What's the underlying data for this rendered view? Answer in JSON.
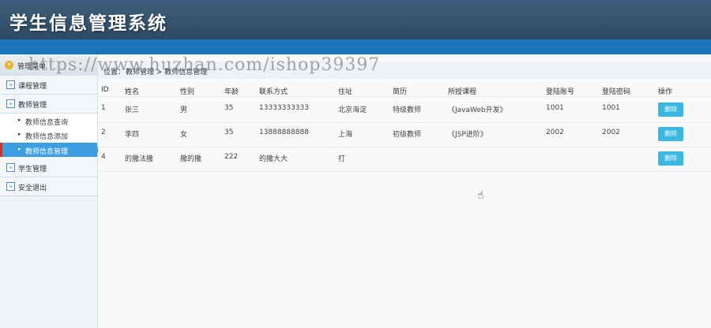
{
  "app": {
    "title": "学生信息管理系统"
  },
  "sidebar": {
    "header_label": "管理菜单",
    "items": [
      {
        "label": "课程管理"
      },
      {
        "label": "教师管理"
      },
      {
        "label": "学生管理"
      },
      {
        "label": "安全退出"
      }
    ],
    "subitems": [
      {
        "label": "教师信息查询"
      },
      {
        "label": "教师信息添加"
      },
      {
        "label": "教师信息管理"
      }
    ]
  },
  "breadcrumb": {
    "prefix": "位置：",
    "path": "教师管理 > 教师信息管理"
  },
  "table": {
    "headers": [
      "ID",
      "姓名",
      "性别",
      "年龄",
      "联系方式",
      "住址",
      "简历",
      "所授课程",
      "登陆账号",
      "登陆密码",
      "操作"
    ],
    "rows": [
      {
        "id": "1",
        "name": "张三",
        "gender": "男",
        "age": "35",
        "phone": "13333333333",
        "address": "北京海淀",
        "resume": "特级教师",
        "course": "《JavaWeb开发》",
        "account": "1001",
        "password": "1001",
        "action": "删除"
      },
      {
        "id": "2",
        "name": "李四",
        "gender": "女",
        "age": "35",
        "phone": "13888888888",
        "address": "上海",
        "resume": "初级教师",
        "course": "《JSP进阶》",
        "account": "2002",
        "password": "2002",
        "action": "删除"
      },
      {
        "id": "4",
        "name": "的撒法撒",
        "gender": "撒的撒",
        "age": "222",
        "phone": "的撒大大",
        "address": "打",
        "resume": "",
        "course": "",
        "account": "",
        "password": "",
        "action": "删除"
      }
    ]
  },
  "watermark": "https://www.huzhan.com/ishop39397",
  "icons": {
    "menu": "circle-menu-icon",
    "nav": "square-nav-icon",
    "sub": "triangle-right-icon",
    "cursor": "hand-pointer-icon"
  },
  "colors": {
    "header": "#34536e",
    "bar": "#1a74b8",
    "active": "#3d9de0",
    "button": "#3ab7e3"
  }
}
